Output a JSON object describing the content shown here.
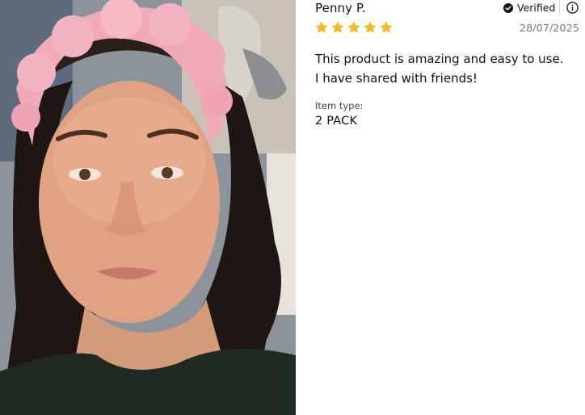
{
  "review": {
    "author": "Penny P.",
    "verified_label": "Verified",
    "rating": 5,
    "rating_max": 5,
    "date": "28/07/2025",
    "body_line_1": "This product is amazing and easy to use.",
    "body_line_2": "I have shared with friends!",
    "item_type_label": "Item type:",
    "item_type_value": "2 PACK"
  },
  "icons": {
    "verified": "check-circle-icon",
    "info": "info-icon",
    "star": "star-icon"
  },
  "colors": {
    "star": "#f5b921",
    "date": "#777777",
    "headband": "#f2a9b8",
    "text": "#111111"
  }
}
